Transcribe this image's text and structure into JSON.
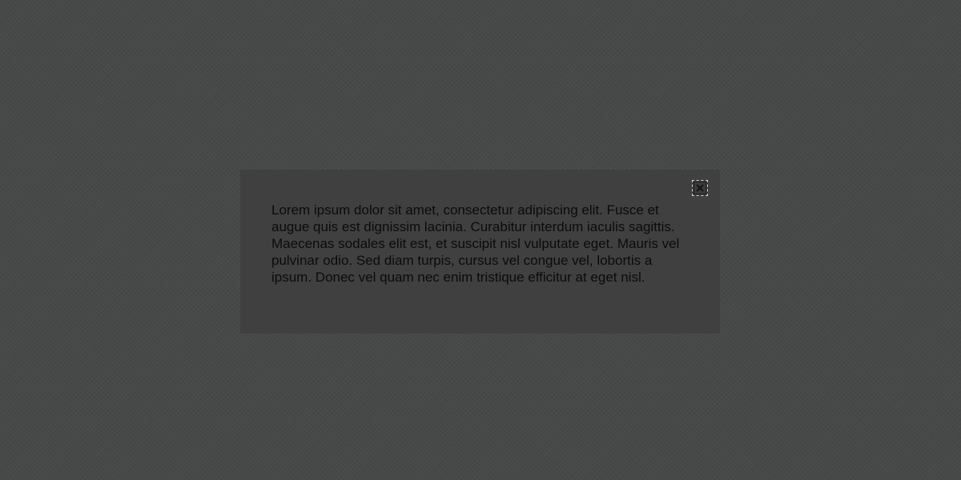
{
  "modal": {
    "body_text": "Lorem ipsum dolor sit amet, consectetur adipiscing elit. Fusce et augue quis est dignissim lacinia. Curabitur interdum iaculis sagittis. Maecenas sodales elit est, et suscipit nisl vulputate eget. Mauris vel pulvinar odio. Sed diam turpis, cursus vel congue vel, lobortis a ipsum. Donec vel quam nec enim tristique efficitur at eget nisl.",
    "close_icon": "close-icon"
  },
  "colors": {
    "backdrop": "#474948",
    "modal_background": "#404040",
    "text": "#0b0b0b"
  }
}
